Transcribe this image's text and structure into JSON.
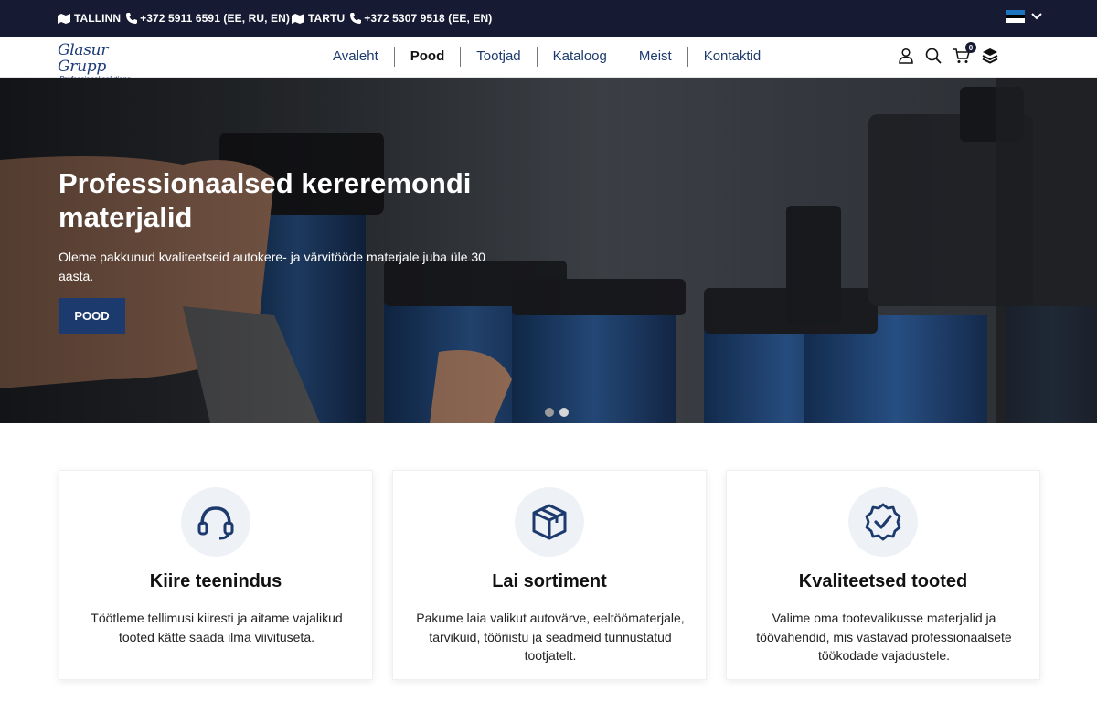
{
  "topbar": {
    "locations": [
      {
        "city": "TALLINN",
        "phone": "+372 5911 6591 (EE, RU, EN)"
      },
      {
        "city": "TARTU",
        "phone": "+372 5307 9518 (EE, EN)"
      }
    ],
    "language_flag": "estonian-flag-icon"
  },
  "nav": {
    "logo_main": "Glasur Grupp",
    "logo_sub": "Professional solutions",
    "items": [
      "Avaleht",
      "Pood",
      "Tootjad",
      "Kataloog",
      "Meist",
      "Kontaktid"
    ],
    "active": "Pood",
    "cart_count": "0"
  },
  "hero": {
    "title": "Professionaalsed kereremondi materjalid",
    "subtitle": "Oleme pakkunud kvaliteetseid autokere- ja värvitööde materjale juba üle 30 aasta.",
    "button": "POOD",
    "slides": 2,
    "active_slide": 1
  },
  "features": [
    {
      "icon": "headset-icon",
      "title": "Kiire teenindus",
      "text": "Töötleme tellimusi kiiresti ja aitame vajalikud tooted kätte saada ilma viivituseta."
    },
    {
      "icon": "box-icon",
      "title": "Lai sortiment",
      "text": "Pakume laia valikut autovärve, eeltöömaterjale, tarvikuid, tööriistu ja seadmeid tunnustatud tootjatelt."
    },
    {
      "icon": "quality-badge-icon",
      "title": "Kvaliteetsed tooted",
      "text": "Valime oma tootevalikusse materjalid ja töövahendid, mis vastavad professionaalsete töökodade vajadustele."
    }
  ],
  "colors": {
    "topbar_bg": "#161a33",
    "brand_blue": "#1c3a6e",
    "card_icon_bg": "#eef1f6"
  }
}
